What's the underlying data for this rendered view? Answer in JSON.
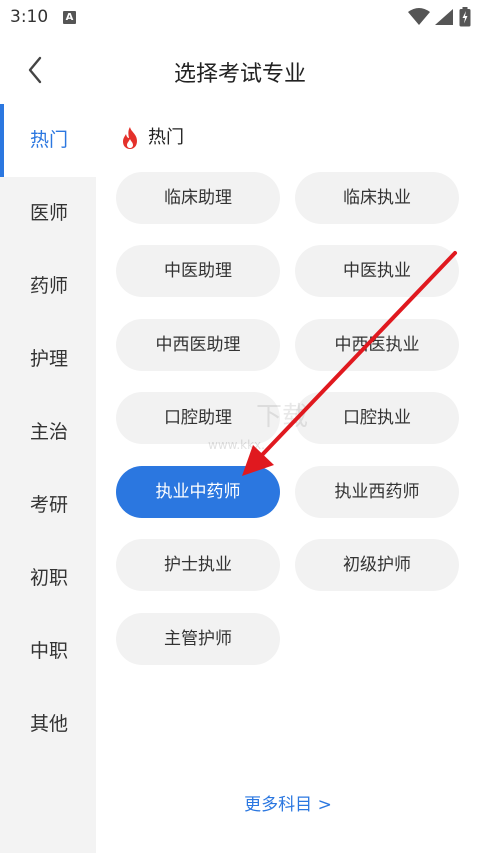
{
  "status_bar": {
    "time": "3:10",
    "notification_badge": "A",
    "icons": [
      "wifi-icon",
      "signal-icon",
      "battery-icon"
    ]
  },
  "header": {
    "back_icon": "chevron-left-icon",
    "title": "选择考试专业"
  },
  "sidebar": {
    "items": [
      {
        "label": "热门",
        "active": true
      },
      {
        "label": "医师",
        "active": false
      },
      {
        "label": "药师",
        "active": false
      },
      {
        "label": "护理",
        "active": false
      },
      {
        "label": "主治",
        "active": false
      },
      {
        "label": "考研",
        "active": false
      },
      {
        "label": "初职",
        "active": false
      },
      {
        "label": "中职",
        "active": false
      },
      {
        "label": "其他",
        "active": false
      }
    ]
  },
  "section": {
    "icon": "fire-icon",
    "title": "热门"
  },
  "options": [
    {
      "label": "临床助理",
      "selected": false
    },
    {
      "label": "临床执业",
      "selected": false
    },
    {
      "label": "中医助理",
      "selected": false
    },
    {
      "label": "中医执业",
      "selected": false
    },
    {
      "label": "中西医助理",
      "selected": false
    },
    {
      "label": "中西医执业",
      "selected": false
    },
    {
      "label": "口腔助理",
      "selected": false
    },
    {
      "label": "口腔执业",
      "selected": false
    },
    {
      "label": "执业中药师",
      "selected": true
    },
    {
      "label": "执业西药师",
      "selected": false
    },
    {
      "label": "护士执业",
      "selected": false
    },
    {
      "label": "初级护师",
      "selected": false
    },
    {
      "label": "主管护师",
      "selected": false
    }
  ],
  "more_link": "更多科目 >",
  "watermark": {
    "text": "下载",
    "url_text": "www.kkx."
  },
  "colors": {
    "accent": "#2b77e0",
    "annotation_arrow": "#e0191f",
    "fire": "#e4312b"
  }
}
